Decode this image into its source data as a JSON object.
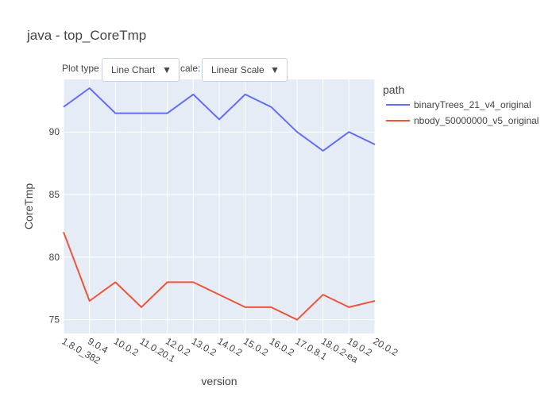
{
  "controls": {
    "plot_type_label": "Plot type",
    "plot_type_value": "Line Chart",
    "scale_label": "cale:",
    "scale_value": "Linear Scale",
    "arrow_icon": "triangle-down-icon"
  },
  "legend": {
    "title": "path"
  },
  "chart_data": {
    "type": "line",
    "title": "java - top_CoreTmp",
    "xlabel": "version",
    "ylabel": "CoreTmp",
    "categories": [
      "1.8.0_382",
      "9.0.4",
      "10.0.2",
      "11.0.20.1",
      "12.0.2",
      "13.0.2",
      "14.0.2",
      "15.0.2",
      "16.0.2",
      "17.0.8.1",
      "18.0.2-ea",
      "19.0.2",
      "20.0.2"
    ],
    "ylim": [
      73.9,
      94.2
    ],
    "yticks": [
      75,
      80,
      85,
      90
    ],
    "grid": true,
    "legend_position": "top-right",
    "series": [
      {
        "name": "binaryTrees_21_v4_original",
        "color": "#636efa",
        "values": [
          92,
          93.5,
          91.5,
          91.5,
          91.5,
          93,
          91,
          93,
          92,
          90,
          88.5,
          90,
          89
        ]
      },
      {
        "name": "nbody_50000000_v5_original",
        "color": "#ef553b",
        "values": [
          82,
          76.5,
          78,
          76,
          78,
          78,
          77,
          76,
          76,
          75,
          77,
          76,
          76.5
        ]
      }
    ]
  }
}
